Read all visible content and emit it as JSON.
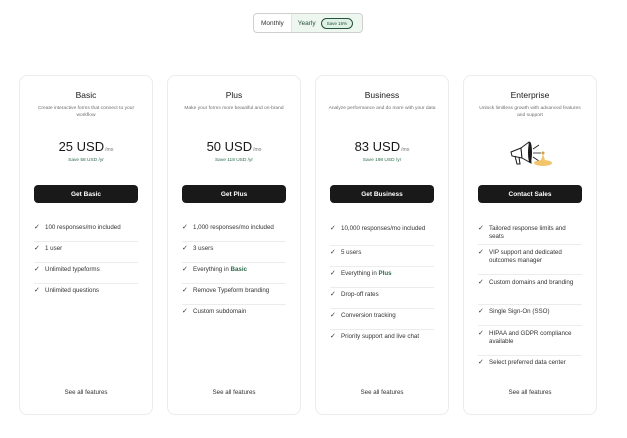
{
  "billing_toggle": {
    "monthly_label": "Monthly",
    "yearly_label": "Yearly",
    "save_badge": "Save 16%"
  },
  "plans": [
    {
      "name": "Basic",
      "description": "Create interactive forms that connect to your workflow",
      "price": "25 USD",
      "period": "/mo",
      "yearly_savings": "Save 58 USD /yr",
      "cta": "Get Basic",
      "features": [
        {
          "text": "100 responses/mo included"
        },
        {
          "text": "1 user"
        },
        {
          "text": "Unlimited typeforms"
        },
        {
          "text": "Unlimited questions"
        }
      ],
      "see_all": "See all features"
    },
    {
      "name": "Plus",
      "description": "Make your forms more beautiful and on-brand",
      "price": "50 USD",
      "period": "/mo",
      "yearly_savings": "Save 118 USD /yr",
      "cta": "Get Plus",
      "features": [
        {
          "text": "1,000 responses/mo included"
        },
        {
          "text": "3 users"
        },
        {
          "prefix": "Everything in ",
          "highlight": "Basic"
        },
        {
          "text": "Remove Typeform branding"
        },
        {
          "text": "Custom subdomain"
        }
      ],
      "see_all": "See all features"
    },
    {
      "name": "Business",
      "description": "Analyze performance and do more with your data",
      "price": "83 USD",
      "period": "/mo",
      "yearly_savings": "Save 198 USD /yr",
      "cta": "Get Business",
      "features": [
        {
          "text": "10,000 responses/mo included"
        },
        {
          "text": "5 users"
        },
        {
          "prefix": "Everything in ",
          "highlight": "Plus"
        },
        {
          "text": "Drop-off rates"
        },
        {
          "text": "Conversion tracking"
        },
        {
          "text": "Priority support and live chat"
        }
      ],
      "see_all": "See all features"
    },
    {
      "name": "Enterprise",
      "description": "Unlock limitless growth with advanced features and support",
      "illustration": "megaphone-illustration",
      "cta": "Contact Sales",
      "features": [
        {
          "text": "Tailored response limits and seats"
        },
        {
          "text": "VIP support and dedicated outcomes manager"
        },
        {
          "text": "Custom domains and branding"
        },
        {
          "text": "Single Sign-On (SSO)"
        },
        {
          "text": "HIPAA and GDPR compliance available"
        },
        {
          "text": "Select preferred data center"
        }
      ],
      "see_all": "See all features"
    }
  ],
  "colors": {
    "accent_green": "#2c6b4a",
    "button_dark": "#191919",
    "toggle_selected_bg": "#eef6f0"
  }
}
